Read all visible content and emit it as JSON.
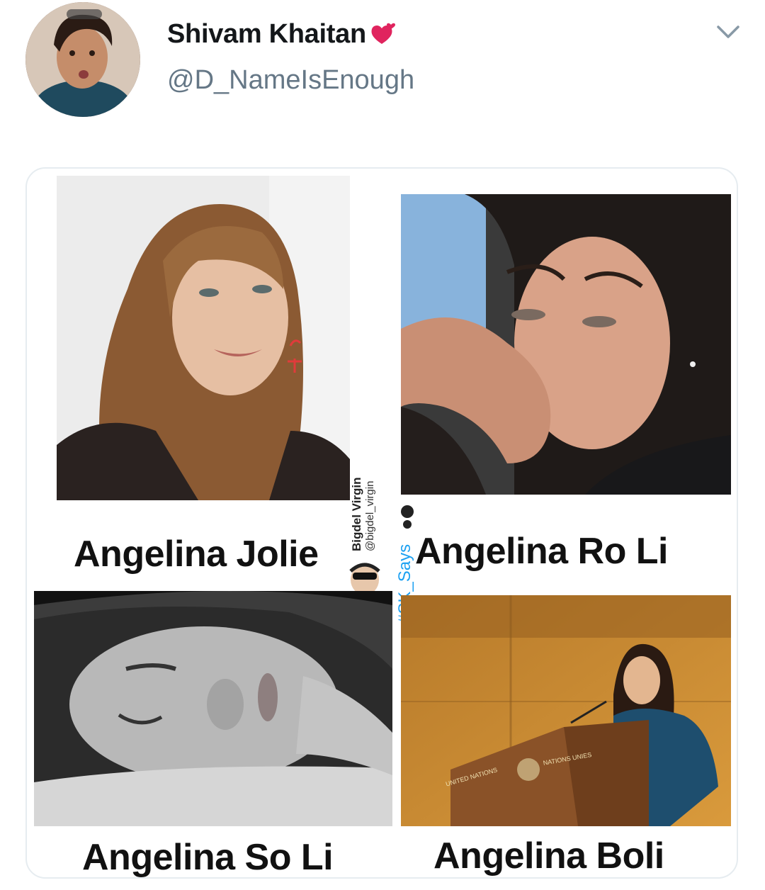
{
  "tweet": {
    "display_name": "Shivam Khaitan",
    "handle": "@D_NameIsEnough",
    "name_emoji": "heart-emoji",
    "menu_icon": "chevron-down-icon"
  },
  "media": {
    "panels": [
      {
        "caption": "Angelina Jolie"
      },
      {
        "caption": "Angelina Ro Li"
      },
      {
        "caption": "Angelina So Li"
      },
      {
        "caption": "Angelina Boli"
      }
    ],
    "watermark": {
      "name": "Bigdel Virgin",
      "handle": "@bigdel_virgin",
      "hashtag": "#SK_Says"
    },
    "podium_text_left": "UNITED NATIONS",
    "podium_text_right": "NATIONS UNIES"
  },
  "colors": {
    "name": "#14171a",
    "handle": "#657786",
    "hashtag": "#1da1f2",
    "heart": "#e0245e"
  }
}
